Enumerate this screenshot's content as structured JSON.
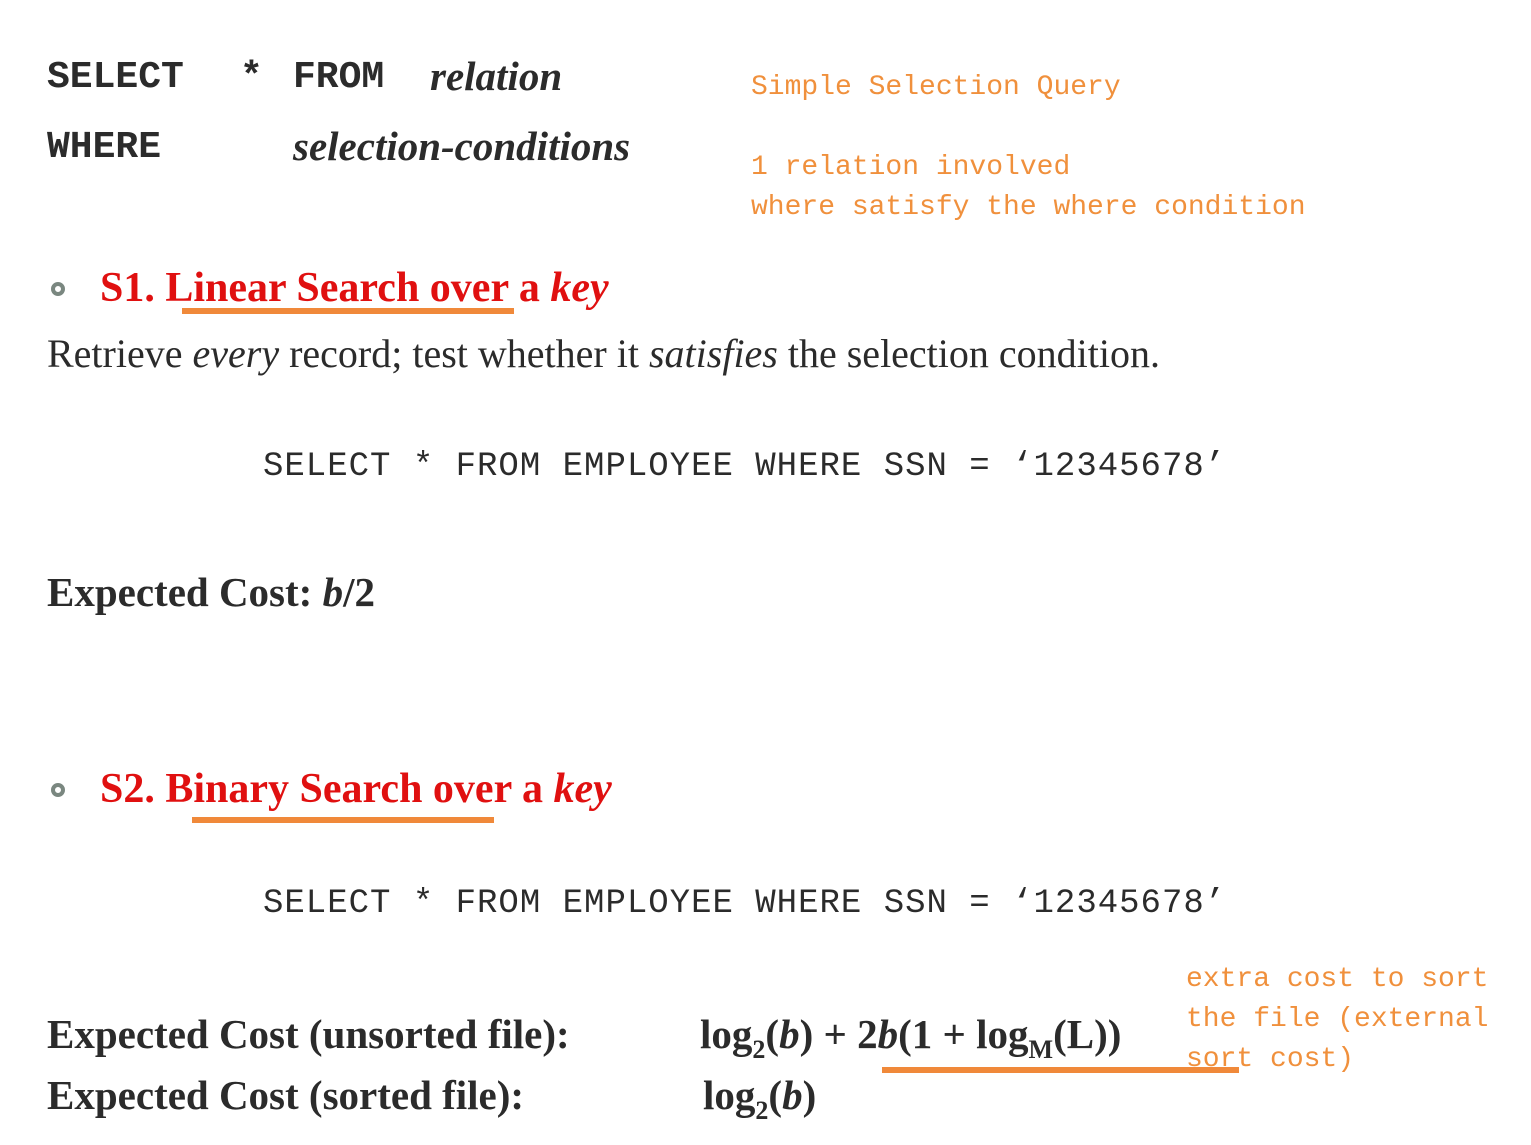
{
  "query": {
    "select_kw": "SELECT",
    "star": "*",
    "from_kw": "FROM",
    "relation": "relation",
    "where_kw": "WHERE",
    "conditions": "selection-conditions"
  },
  "notes": {
    "title": "Simple Selection Query",
    "line1": "1 relation involved",
    "line2": "where satisfy the where condition"
  },
  "s1": {
    "number": "S1.",
    "title_main": "Linear Search over a",
    "title_key": "key",
    "desc_a": "Retrieve ",
    "desc_every": "every",
    "desc_b": " record; test whether it ",
    "desc_satisfies": "satisfies",
    "desc_c": " the selection condition.",
    "code": "SELECT * FROM EMPLOYEE WHERE SSN = ‘12345678’",
    "cost_label": "Expected Cost:",
    "cost_b": "b",
    "cost_rest": "/2"
  },
  "s2": {
    "number": "S2.",
    "title_main": "Binary Search over a",
    "title_key": "key",
    "code": "SELECT * FROM EMPLOYEE WHERE SSN = ‘12345678’",
    "cost_unsorted_label": "Expected Cost (unsorted file):",
    "cost_sorted_label": "Expected Cost (sorted file):",
    "note1": "extra cost to sort",
    "note2": "the file (external",
    "note3": "sort cost)"
  },
  "colors": {
    "heading": "#e01010",
    "annotation": "#f0903c",
    "text": "#2b2b2b"
  }
}
